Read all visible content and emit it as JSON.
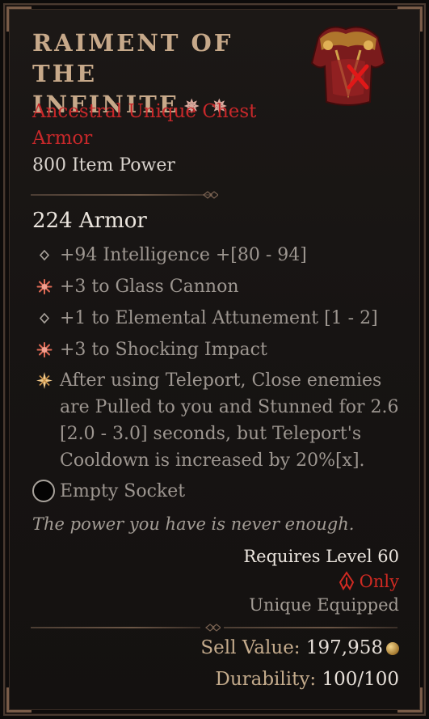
{
  "item": {
    "name_line1": "RAIMENT OF THE",
    "name_line2": "INFINITE",
    "gem_glyphs": "✵ ✵",
    "type_line1": "Ancestral Unique Chest",
    "type_line2": "Armor",
    "item_power": "800 Item Power",
    "armor": "224 Armor",
    "item_art_icon": "chest-armor-icon",
    "class_restriction_mark": "red-x-icon"
  },
  "affixes": [
    {
      "icon": "diamond-bullet-icon",
      "text": "+94 Intelligence +[80 - 94]"
    },
    {
      "icon": "red-star-icon",
      "text": "+3 to Glass Cannon"
    },
    {
      "icon": "diamond-bullet-icon",
      "text": "+1 to Elemental Attunement [1 - 2]"
    },
    {
      "icon": "red-star-icon",
      "text": "+3 to Shocking Impact"
    },
    {
      "icon": "unique-star-icon",
      "text": "After using Teleport, Close enemies are Pulled to you and Stunned for 2.6 [2.0 - 3.0] seconds, but Teleport's Cooldown is increased by 20%[x]."
    }
  ],
  "socket": {
    "icon": "empty-socket-icon",
    "label": "Empty Socket"
  },
  "flavor_text": "The power you have is never enough.",
  "requirements": {
    "level": "Requires Level 60",
    "class_only": "Only",
    "class_icon": "sorcerer-class-icon",
    "unique": "Unique Equipped"
  },
  "footer": {
    "sell_label": "Sell Value:",
    "sell_value": "197,958",
    "coin_icon": "gold-coin-icon",
    "durability_label": "Durability:",
    "durability_value": "100/100"
  },
  "colors": {
    "title": "#c7a98a",
    "unique_red": "#c8282a",
    "affix_grey": "#9d9690",
    "bright_text": "#ece6df",
    "label_tan": "#c4ab8c"
  }
}
